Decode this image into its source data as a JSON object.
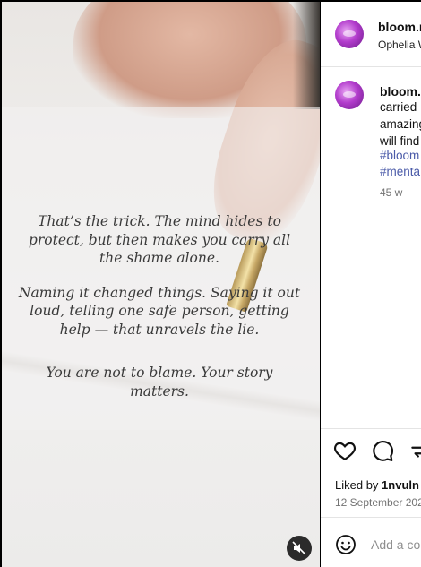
{
  "media": {
    "text_lines": [
      "That’s the trick. The mind hides to protect, but then makes you carry all the shame alone.",
      "Naming it changed things. Saying it out loud, telling one safe person, getting help — that unravels the lie.",
      "You are not to blame. Your story matters."
    ],
    "mute_icon": "muted-speaker-icon"
  },
  "header": {
    "username": "bloom.r",
    "subtitle": "Ophelia W"
  },
  "caption": {
    "username": "bloom.",
    "lines": [
      "carried",
      "amazing",
      "will find"
    ],
    "hashtags": [
      "#bloom",
      "#menta"
    ],
    "time": "45 w"
  },
  "actions": {
    "icons": [
      "heart-icon",
      "comment-icon",
      "share-icon"
    ]
  },
  "likes": {
    "prefix": "Liked by",
    "user": "1nvuln"
  },
  "date": "12 September 202",
  "comment": {
    "placeholder": "Add a co",
    "emoji_icon": "emoji-icon"
  },
  "colors": {
    "background": "#000000",
    "panel": "#ffffff",
    "hashtag": "#4a5aa8",
    "muted_text": "#737373"
  }
}
